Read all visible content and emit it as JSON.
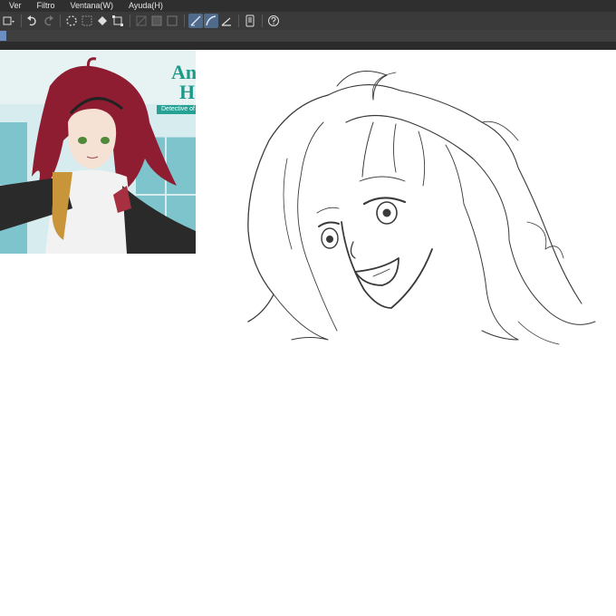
{
  "menu": {
    "items": [
      "Ver",
      "Filtro",
      "Ventana(W)",
      "Ayuda(H)"
    ]
  },
  "toolbar": {
    "icons": [
      "layer-dropdown-icon",
      "undo-icon",
      "redo-icon",
      "loading-spinner-icon",
      "deselect-icon",
      "fill-icon",
      "transform-icon",
      "grid-off-icon",
      "grid-icon",
      "square-icon",
      "ruler-snap-icon",
      "curve-snap-icon",
      "angle-ruler-icon",
      "device-icon",
      "help-icon"
    ]
  },
  "reference_image": {
    "title_line1": "An",
    "title_line2": "Ha",
    "banner": "Detective of"
  },
  "colors": {
    "menubar_bg": "#2f2f2f",
    "toolbar_bg": "#3a3a3a",
    "accent": "#6b8fc0",
    "brand_teal": "#1f9a8a"
  }
}
